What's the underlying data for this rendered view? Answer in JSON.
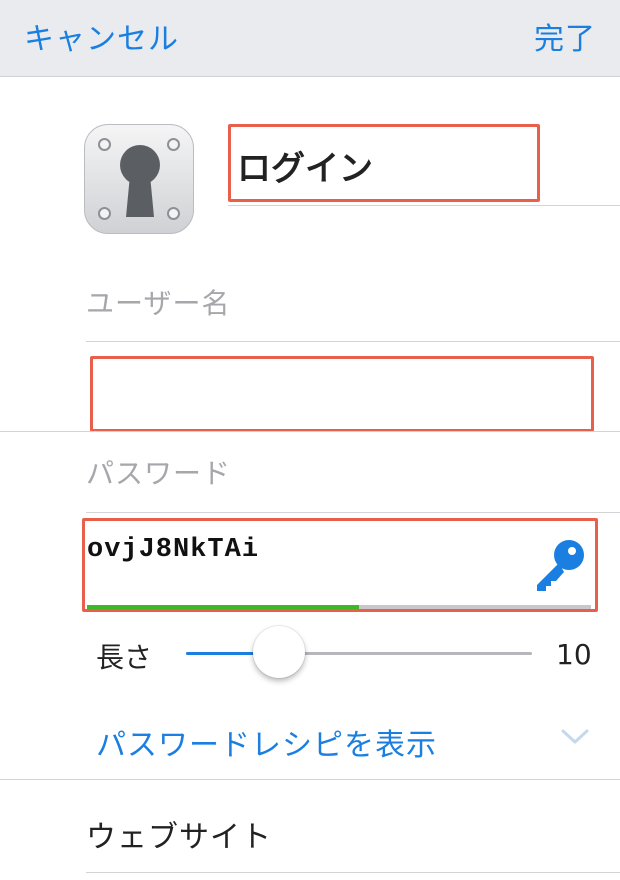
{
  "navbar": {
    "cancel_label": "キャンセル",
    "done_label": "完了"
  },
  "item": {
    "icon": "keyhole-icon",
    "title": "ログイン"
  },
  "username": {
    "label": "ユーザー名",
    "value": ""
  },
  "password": {
    "label": "パスワード",
    "value": "ovjJ8NkTAi",
    "strength": 0.54,
    "generator_icon": "key-icon"
  },
  "length": {
    "label": "長さ",
    "value": "10",
    "slider_fraction": 0.27
  },
  "recipe": {
    "label": "パスワードレシピを表示",
    "icon": "chevron-down-icon"
  },
  "website": {
    "label": "ウェブサイト"
  },
  "colors": {
    "accent": "#1a7fe0",
    "highlight": "#e8604c",
    "strength": "#3cb829"
  }
}
